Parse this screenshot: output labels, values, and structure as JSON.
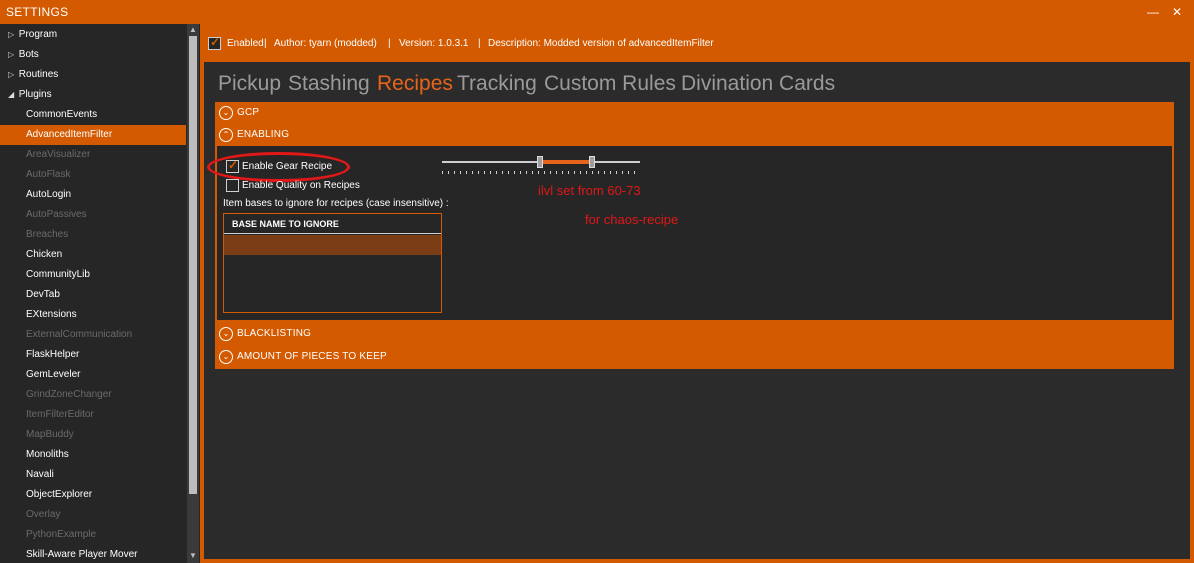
{
  "window": {
    "title": "SETTINGS",
    "minimize_glyph": "—",
    "close_glyph": "✕"
  },
  "sidebar": {
    "categories": [
      {
        "label": "Program",
        "arrow": "▷"
      },
      {
        "label": "Bots",
        "arrow": "▷"
      },
      {
        "label": "Routines",
        "arrow": "▷"
      },
      {
        "label": "Plugins",
        "arrow": "◢"
      }
    ],
    "plugins": [
      {
        "label": "CommonEvents",
        "enabled": true
      },
      {
        "label": "AdvancedItemFilter",
        "enabled": true,
        "selected": true
      },
      {
        "label": "AreaVisualizer",
        "enabled": false
      },
      {
        "label": "AutoFlask",
        "enabled": false
      },
      {
        "label": "AutoLogin",
        "enabled": true
      },
      {
        "label": "AutoPassives",
        "enabled": false
      },
      {
        "label": "Breaches",
        "enabled": false
      },
      {
        "label": "Chicken",
        "enabled": true
      },
      {
        "label": "CommunityLib",
        "enabled": true
      },
      {
        "label": "DevTab",
        "enabled": true
      },
      {
        "label": "EXtensions",
        "enabled": true
      },
      {
        "label": "ExternalCommunication",
        "enabled": false
      },
      {
        "label": "FlaskHelper",
        "enabled": true
      },
      {
        "label": "GemLeveler",
        "enabled": true
      },
      {
        "label": "GrindZoneChanger",
        "enabled": false
      },
      {
        "label": "ItemFilterEditor",
        "enabled": false
      },
      {
        "label": "MapBuddy",
        "enabled": false
      },
      {
        "label": "Monoliths",
        "enabled": true
      },
      {
        "label": "Navali",
        "enabled": true
      },
      {
        "label": "ObjectExplorer",
        "enabled": true
      },
      {
        "label": "Overlay",
        "enabled": false
      },
      {
        "label": "PythonExample",
        "enabled": false
      },
      {
        "label": "Skill-Aware Player Mover",
        "enabled": true
      }
    ]
  },
  "plugin_info": {
    "enabled_label": "Enabled",
    "author": "Author:   tyarn (modded)",
    "version": "Version:   1.0.3.1",
    "description": "Description:   Modded version of advancedItemFilter",
    "separator": "|"
  },
  "tabs": [
    {
      "label": "Pickup",
      "active": false
    },
    {
      "label": "Stashing",
      "active": false
    },
    {
      "label": "Recipes",
      "active": true
    },
    {
      "label": "Tracking",
      "active": false
    },
    {
      "label": "Custom Rules",
      "active": false
    },
    {
      "label": "Divination Cards",
      "active": false
    }
  ],
  "sections": {
    "gcp": "GCP",
    "enabling": "ENABLING",
    "blacklisting": "BLACKLISTING",
    "amount": "AMOUNT OF PIECES TO KEEP",
    "expand_glyph": "⌄",
    "collapse_glyph": "⌃"
  },
  "enabling": {
    "gear_recipe_label": "Enable Gear Recipe",
    "gear_recipe_checked": true,
    "quality_label": "Enable Quality on Recipes",
    "quality_checked": false,
    "ignore_hint": "Item bases to ignore for recipes (case insensitive) :",
    "ignore_table_header": "BASE NAME TO IGNORE",
    "ilvl_range": {
      "min": 60,
      "max": 73
    }
  },
  "annotations": {
    "line1": "ilvl set from 60-73",
    "line2": "for chaos-recipe"
  },
  "colors": {
    "accent": "#d35a00",
    "annotation": "#e01818"
  }
}
